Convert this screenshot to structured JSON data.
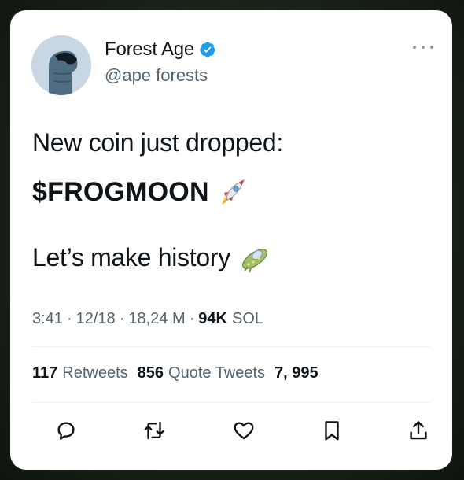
{
  "tweet": {
    "author": {
      "display_name": "Forest Age",
      "handle": "@ape forests",
      "verified": true
    },
    "text_line1": "New coin just dropped:",
    "text_line2": "$FROGMOON",
    "text_line3": "Let’s make history",
    "meta": {
      "time": "3:41",
      "date": "12/18",
      "views": "18,24 M",
      "amount_value": "94K",
      "amount_unit": "SOL"
    },
    "stats": {
      "retweets_count": "117",
      "retweets_label": "Retweets",
      "quotes_count": "856",
      "quotes_label": "Quote Tweets",
      "likes_count": "7, 995"
    },
    "actions": [
      "reply-icon",
      "retweet-icon",
      "like-icon",
      "bookmark-icon",
      "share-icon"
    ],
    "colors": {
      "verified_blue": "#1d9bf0",
      "text": "#0f1419",
      "secondary": "#536471"
    }
  }
}
